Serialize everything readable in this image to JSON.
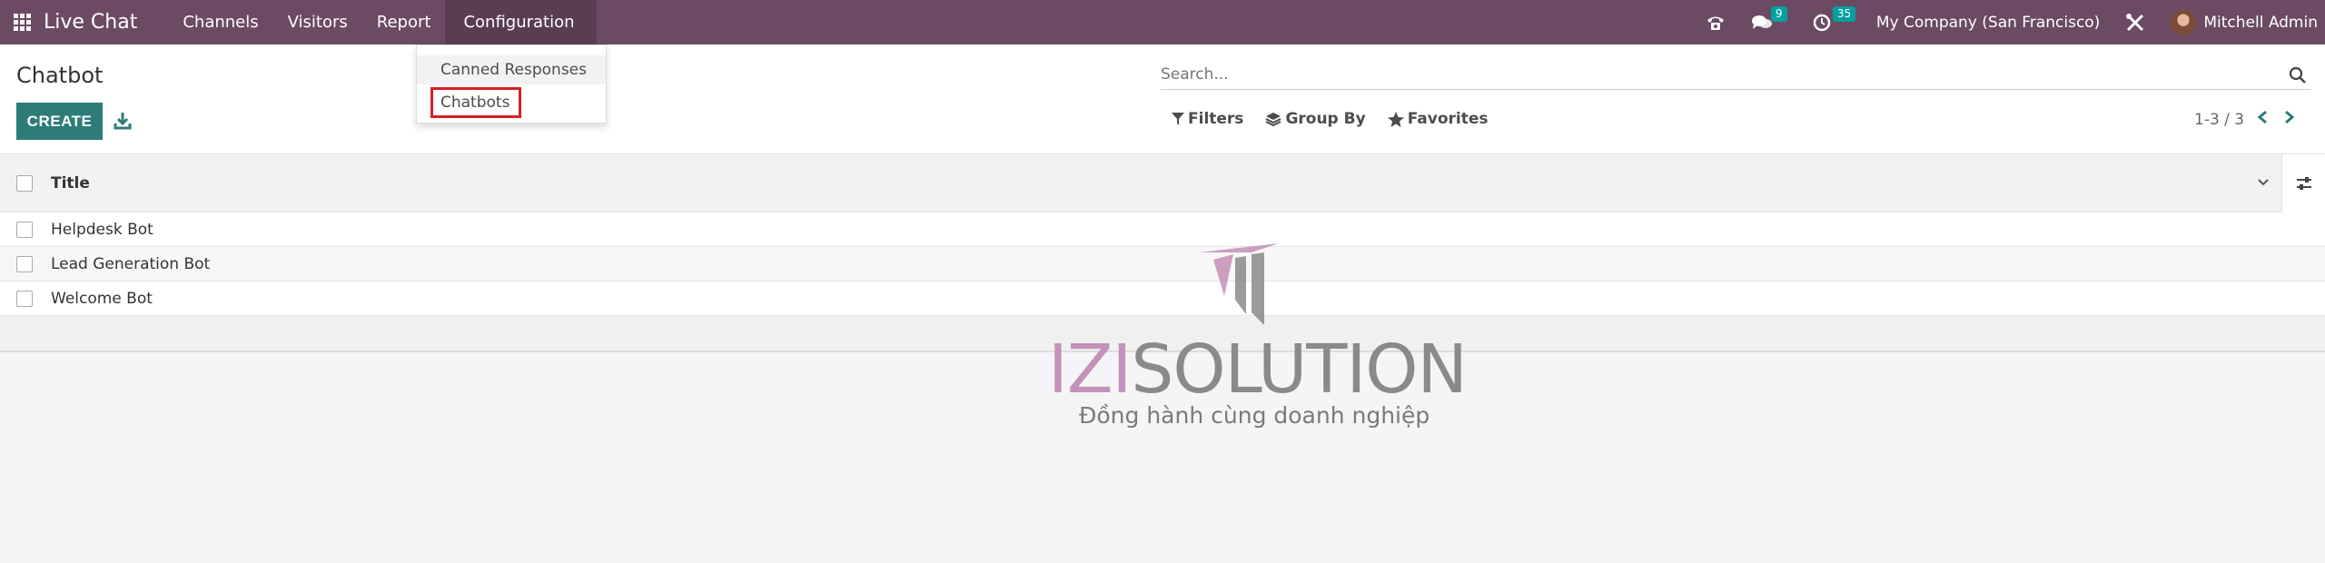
{
  "navbar": {
    "app_title": "Live Chat",
    "menu": [
      "Channels",
      "Visitors",
      "Report",
      "Configuration"
    ],
    "messages_badge": "9",
    "activities_badge": "35",
    "company": "My Company (San Francisco)",
    "user": "Mitchell Admin"
  },
  "dropdown": {
    "items": [
      "Canned Responses",
      "Chatbots"
    ]
  },
  "control": {
    "breadcrumb": "Chatbot",
    "create_label": "CREATE",
    "search_placeholder": "Search...",
    "filters_label": "Filters",
    "groupby_label": "Group By",
    "favorites_label": "Favorites",
    "pager": "1-3 / 3"
  },
  "table": {
    "header": "Title",
    "rows": [
      "Helpdesk Bot",
      "Lead Generation Bot",
      "Welcome Bot"
    ]
  },
  "watermark": {
    "part1": "IZI",
    "part2": "SOLUTION",
    "tagline": "Đồng hành cùng doanh nghiệp"
  },
  "colors": {
    "navbar": "#6c4a64",
    "primary": "#2e7c78",
    "badge": "#00a09d",
    "highlight": "#d81f26"
  }
}
